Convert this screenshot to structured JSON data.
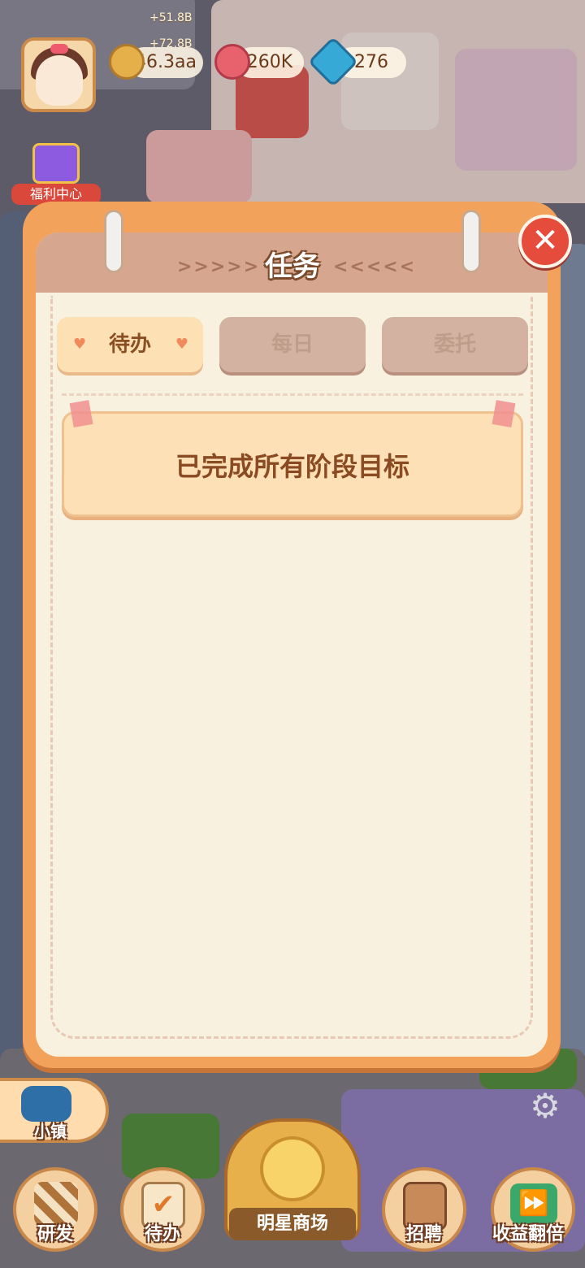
{
  "hud": {
    "float_texts": [
      "+51.8B",
      "+72.8B"
    ],
    "resources": [
      {
        "icon": "acorn-icon",
        "value": "46.3aa",
        "color": "#e5b04a"
      },
      {
        "icon": "rose-icon",
        "value": "260K",
        "color": "#e8626e"
      },
      {
        "icon": "diamond-icon",
        "value": "276",
        "color": "#37a9d6"
      }
    ],
    "welfare_label": "福利中心"
  },
  "modal": {
    "title": "任务",
    "title_deco_left": ">>>>>",
    "title_deco_right": "<<<<<",
    "tabs": [
      {
        "label": "待办",
        "state": "active"
      },
      {
        "label": "每日",
        "state": "inactive"
      },
      {
        "label": "委托",
        "state": "inactive"
      }
    ],
    "card_text": "已完成所有阶段目标"
  },
  "bottom_bar": {
    "town_label": "小镇",
    "buttons": [
      {
        "label": "研发",
        "icon": "research-icon"
      },
      {
        "label": "待办",
        "icon": "checklist-icon"
      },
      {
        "label": "明星商场",
        "icon": "mall-icon"
      },
      {
        "label": "招聘",
        "icon": "recruit-icon"
      },
      {
        "label": "收益翻倍",
        "icon": "fast-forward-icon"
      }
    ]
  },
  "colors": {
    "modal_frame": "#f3a25b",
    "modal_paper": "#f8f1e0",
    "header_band": "#d6a68e",
    "tab_active": "#fde0b3",
    "tab_inactive": "#d4b2a2",
    "close_button": "#e64c3c"
  }
}
